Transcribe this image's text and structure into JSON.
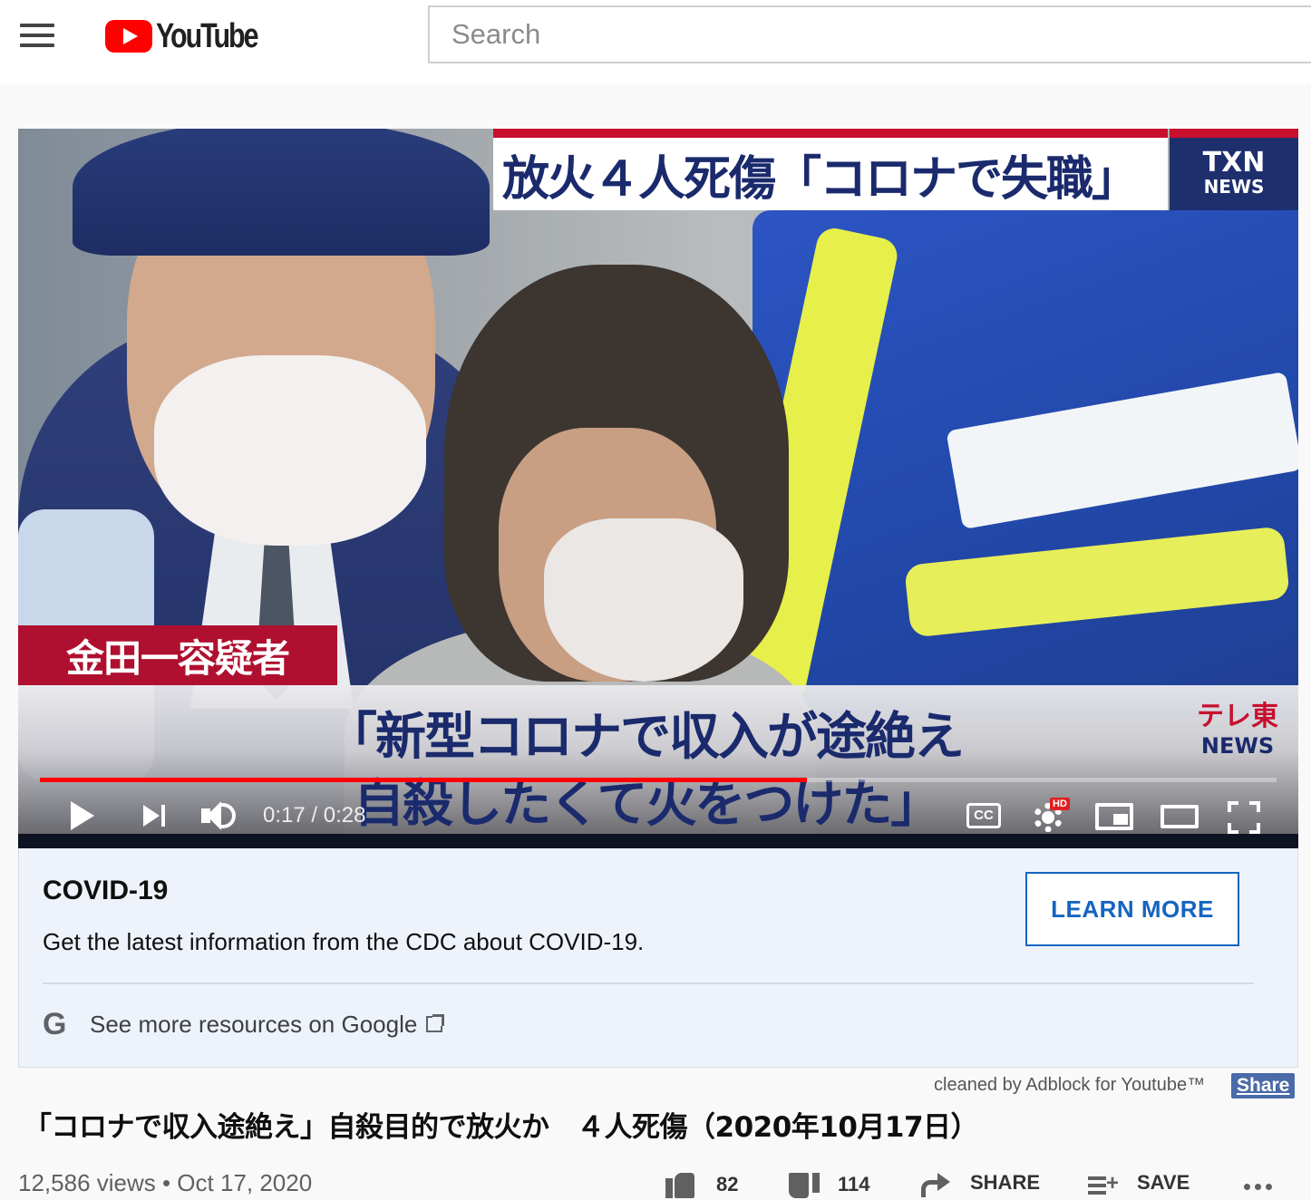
{
  "header": {
    "logo_text": "YouTube",
    "search_placeholder": "Search"
  },
  "video": {
    "overlay_headline": "放火４人死傷「コロナで失職」",
    "network_badge_line1": "TXN",
    "network_badge_line2": "NEWS",
    "name_plate": "金田一容疑者",
    "caption_line1": "「新型コロナで収入が途絶え",
    "caption_line2": "自殺したくて火をつけた」",
    "corner_logo_line1": "テレ東",
    "corner_logo_line2": "NEWS",
    "current_time": "0:17",
    "duration": "0:28",
    "time_display": "0:17 / 0:28",
    "progress_fraction": 0.62,
    "cc_label": "CC",
    "hd_badge": "HD"
  },
  "info_panel": {
    "title": "COVID-19",
    "description": "Get the latest information from the CDC about COVID-19.",
    "button_label": "LEARN MORE",
    "google_link": "See more resources on Google",
    "google_letter": "G"
  },
  "adblock": {
    "note": "cleaned by Adblock for Youtube™",
    "share_label": "Share"
  },
  "title": "「コロナで収入途絶え」自殺目的で放火か　４人死傷（2020年10月17日）",
  "meta": {
    "views_date": "12,586 views • Oct 17, 2020",
    "likes": "82",
    "dislikes": "114",
    "share_label": "SHARE",
    "save_label": "SAVE"
  },
  "colors": {
    "youtube_red": "#ff0000",
    "link_blue": "#1565c0",
    "news_navy": "#1a2a6c",
    "news_red": "#c8102e"
  }
}
